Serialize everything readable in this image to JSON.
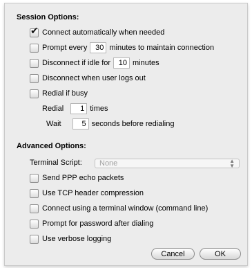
{
  "session": {
    "title": "Session Options:",
    "connect_auto": {
      "label": "Connect automatically when needed",
      "checked": true
    },
    "prompt_every": {
      "pre": "Prompt every",
      "value": "30",
      "post": "minutes to maintain connection",
      "checked": false
    },
    "disconnect_idle": {
      "pre": "Disconnect if idle for",
      "value": "10",
      "post": "minutes",
      "checked": false
    },
    "disconnect_logout": {
      "label": "Disconnect when user logs out",
      "checked": false
    },
    "redial_busy": {
      "label": "Redial if busy",
      "checked": false
    },
    "redial": {
      "pre": "Redial",
      "value": "1",
      "post": "times"
    },
    "wait": {
      "pre": "Wait",
      "value": "5",
      "post": "seconds before redialing"
    }
  },
  "advanced": {
    "title": "Advanced Options:",
    "terminal_script_label": "Terminal Script:",
    "terminal_script_value": "None",
    "options": [
      {
        "label": "Send PPP echo packets",
        "checked": false
      },
      {
        "label": "Use TCP header compression",
        "checked": false
      },
      {
        "label": "Connect using a terminal window (command line)",
        "checked": false
      },
      {
        "label": "Prompt for password after dialing",
        "checked": false
      },
      {
        "label": "Use verbose logging",
        "checked": false
      }
    ]
  },
  "buttons": {
    "cancel": "Cancel",
    "ok": "OK"
  },
  "icons": {
    "checkbox_checked": "checkmark-icon",
    "popup_arrows": "up-down-arrows-icon"
  }
}
